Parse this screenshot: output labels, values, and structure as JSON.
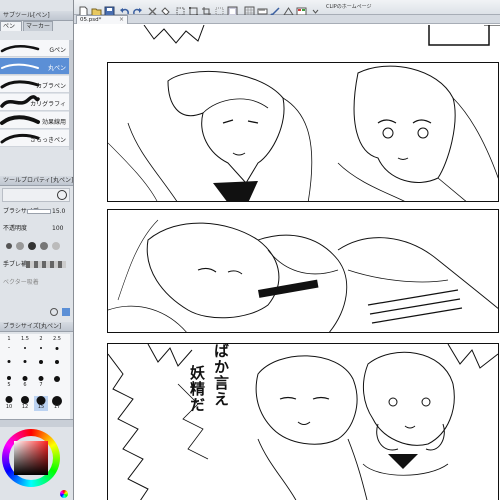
{
  "left_panel": {
    "subtool_header": "サブツール[ペン]",
    "tabs": [
      "ペン",
      "マーカー"
    ],
    "brushes": [
      {
        "label": "Gペン"
      },
      {
        "label": "丸ペン"
      },
      {
        "label": "カブラペン"
      },
      {
        "label": "カリグラフィ"
      },
      {
        "label": "効果線用"
      },
      {
        "label": "さらっきペン"
      }
    ],
    "selected_brush_index": 1,
    "toolprop_header": "ツールプロパティ[丸ペン]",
    "props": {
      "size_label": "ブラシサイズ",
      "size_value": "15.0",
      "opacity_label": "不透明度",
      "opacity_value": "100",
      "stabilize_label": "手ブレ補正",
      "vector_label": "ベクター吸着"
    },
    "brushsize_header": "ブラシサイズ[丸ペン]",
    "size_grid": [
      "1",
      "1.5",
      "2",
      "2.5",
      "",
      "",
      "",
      "",
      "5",
      "6",
      "7",
      "",
      "10",
      "12",
      "15",
      "17"
    ]
  },
  "toolbar": {
    "label": "CLIPのホームページ"
  },
  "document": {
    "tab_name": "05.psd*",
    "close_glyph": "×"
  },
  "manga": {
    "speech_line1": "ばか言え",
    "speech_line2": "妖精だ"
  },
  "colors": {
    "selection": "#5b8fd6",
    "panel_bg": "#dfe3e8",
    "ink": "#111111"
  }
}
